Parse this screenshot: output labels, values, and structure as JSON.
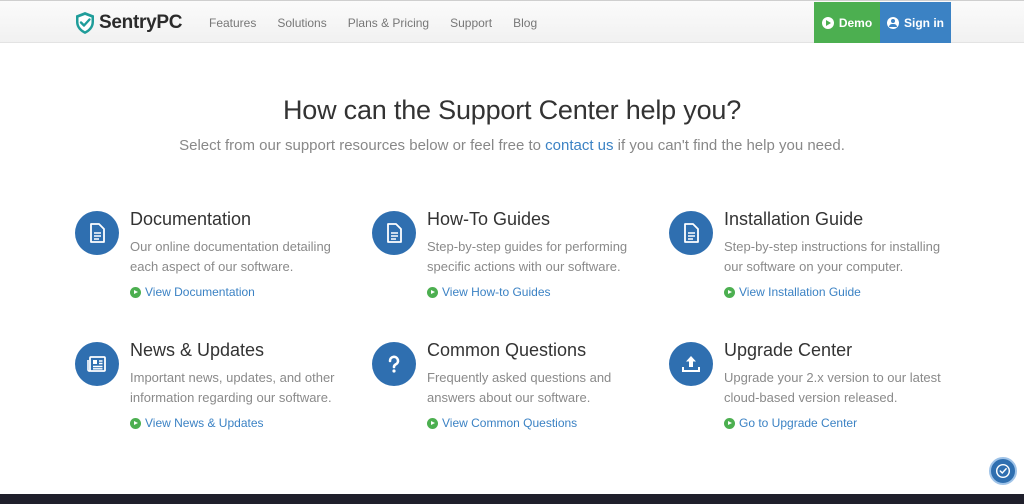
{
  "header": {
    "brand": "SentryPC",
    "nav": [
      "Features",
      "Solutions",
      "Plans & Pricing",
      "Support",
      "Blog"
    ],
    "demo_label": "Demo",
    "signin_label": "Sign in"
  },
  "hero": {
    "title": "How can the Support Center help you?",
    "sub_before": "Select from our support resources below or feel free to ",
    "sub_link": "contact us",
    "sub_after": " if you can't find the help you need."
  },
  "cards": [
    {
      "title": "Documentation",
      "desc": "Our online documentation detailing each aspect of our software.",
      "link": "View Documentation",
      "icon": "document-icon"
    },
    {
      "title": "How-To Guides",
      "desc": "Step-by-step guides for performing specific actions with our software.",
      "link": "View How-to Guides",
      "icon": "document-icon"
    },
    {
      "title": "Installation Guide",
      "desc": "Step-by-step instructions for installing our software on your computer.",
      "link": "View Installation Guide",
      "icon": "document-icon"
    },
    {
      "title": "News & Updates",
      "desc": "Important news, updates, and other information regarding our software.",
      "link": "View News & Updates",
      "icon": "newspaper-icon"
    },
    {
      "title": "Common Questions",
      "desc": "Frequently asked questions and answers about our software.",
      "link": "View Common Questions",
      "icon": "question-icon"
    },
    {
      "title": "Upgrade Center",
      "desc": "Upgrade your 2.x version to our latest cloud-based version released.",
      "link": "Go to Upgrade Center",
      "icon": "upload-icon"
    }
  ],
  "colors": {
    "accent_blue": "#3b82c4",
    "demo_green": "#4caf50",
    "icon_circle": "#2f6fb0"
  }
}
